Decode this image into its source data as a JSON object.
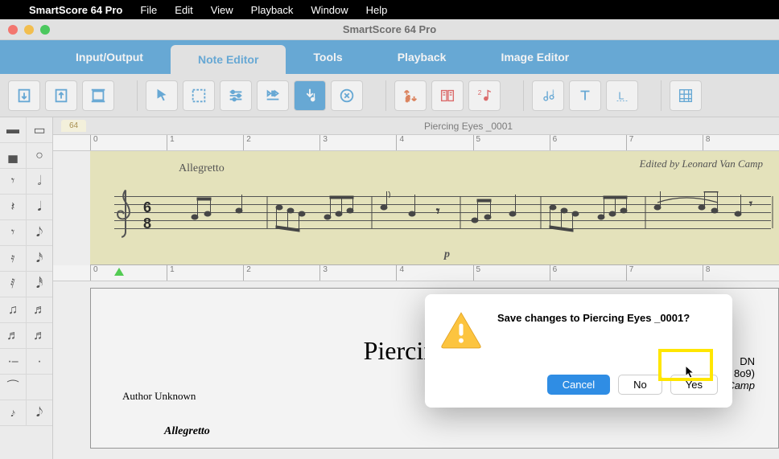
{
  "menubar": {
    "appname": "SmartScore 64 Pro",
    "items": [
      "File",
      "Edit",
      "View",
      "Playback",
      "Window",
      "Help"
    ]
  },
  "window": {
    "title": "SmartScore 64 Pro"
  },
  "tabs": [
    {
      "label": "Input/Output",
      "active": false
    },
    {
      "label": "Note Editor",
      "active": true
    },
    {
      "label": "Tools",
      "active": false
    },
    {
      "label": "Playback",
      "active": false
    },
    {
      "label": "Image Editor",
      "active": false
    }
  ],
  "document": {
    "tab_label": "64",
    "title": "Piercing Eyes _0001",
    "score_top": {
      "tempo": "Allegretto",
      "edited_by": "Edited by Leonard Van Camp",
      "time_sig_top": "6",
      "time_sig_bottom": "8",
      "dynamic": "p"
    },
    "score_main": {
      "title": "Piercing Eyes",
      "author": "Author Unknown",
      "composer_line1": "DN",
      "composer_line2": "(1732- 1 8o9)",
      "composer_line3": "Edited by Leonard Van Camp",
      "tempo": "Allegretto"
    }
  },
  "ruler": [
    "0",
    "1",
    "2",
    "3",
    "4",
    "5",
    "6",
    "7",
    "8"
  ],
  "dialog": {
    "message": "Save changes to Piercing Eyes _0001?",
    "cancel": "Cancel",
    "no": "No",
    "yes": "Yes"
  },
  "icons": {
    "apple": "",
    "toolbar": [
      "↧",
      "↥",
      "▭",
      "↖",
      "▭",
      "⚙",
      "⊞",
      "♪",
      "✕",
      "♯",
      "⎘",
      "♪2",
      "⋮",
      "T",
      "L",
      "▦"
    ]
  }
}
